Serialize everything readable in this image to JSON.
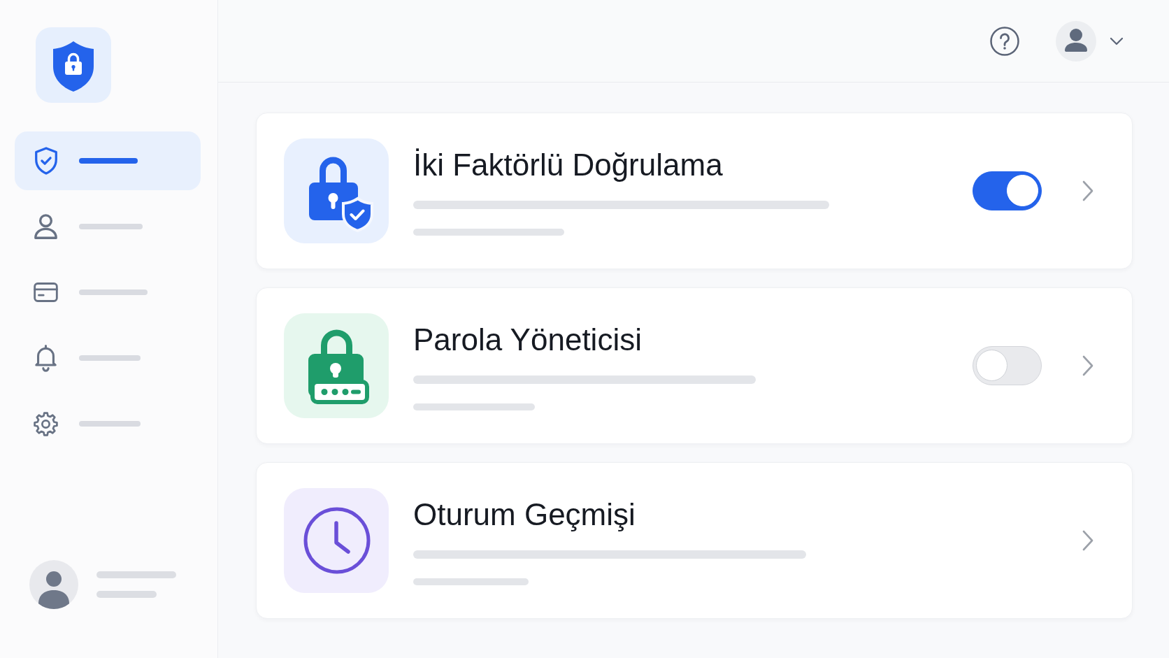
{
  "sidebar": {
    "items": [
      {
        "selected": true
      },
      {
        "selected": false
      },
      {
        "selected": false
      },
      {
        "selected": false
      },
      {
        "selected": false
      }
    ]
  },
  "cards": [
    {
      "title": "İki Faktörlü Doğrulama",
      "kind": "toggle",
      "on": true
    },
    {
      "title": "Parola Yöneticisi",
      "kind": "toggle",
      "on": false
    },
    {
      "title": "Oturum Geçmişi",
      "kind": "link"
    }
  ]
}
